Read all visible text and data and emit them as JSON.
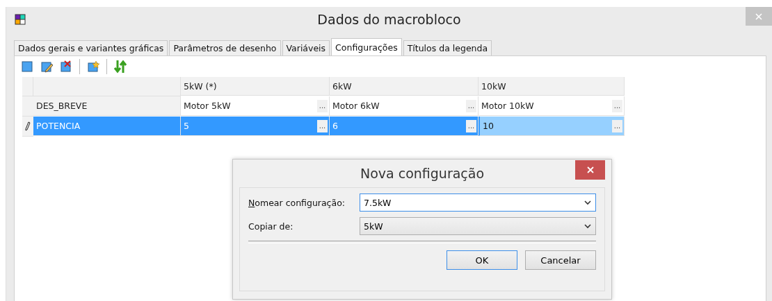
{
  "window": {
    "title": "Dados do macrobloco"
  },
  "tabs": [
    {
      "label": "Dados gerais e variantes gráficas",
      "selected": false
    },
    {
      "label": "Parâmetros de desenho",
      "selected": false
    },
    {
      "label": "Variáveis",
      "selected": false
    },
    {
      "label": "Configurações",
      "selected": true
    },
    {
      "label": "Títulos da legenda",
      "selected": false
    }
  ],
  "table": {
    "columns": [
      "5kW (*)",
      "6kW",
      "10kW"
    ],
    "rows": [
      {
        "name": "DES_BREVE",
        "selected": false,
        "editing": false,
        "cells": [
          {
            "value": "Motor 5kW",
            "current": false,
            "button": "..."
          },
          {
            "value": "Motor 6kW",
            "current": false,
            "button": "..."
          },
          {
            "value": "Motor 10kW",
            "current": false,
            "button": "..."
          }
        ]
      },
      {
        "name": "POTENCIA",
        "selected": true,
        "editing": true,
        "cells": [
          {
            "value": "5",
            "current": false,
            "button": "..."
          },
          {
            "value": "6",
            "current": false,
            "button": "..."
          },
          {
            "value": "10",
            "current": true,
            "button": "..."
          }
        ]
      }
    ]
  },
  "dialog": {
    "title": "Nova configuração",
    "fields": [
      {
        "label": "Nomear configuração:",
        "value": "7.5kW",
        "kind": "editable",
        "focused": true
      },
      {
        "label": "Copiar de:",
        "value": "5kW",
        "kind": "dropdown",
        "focused": false
      }
    ],
    "buttons": [
      {
        "label": "OK",
        "default": true
      },
      {
        "label": "Cancelar",
        "default": false
      }
    ]
  }
}
